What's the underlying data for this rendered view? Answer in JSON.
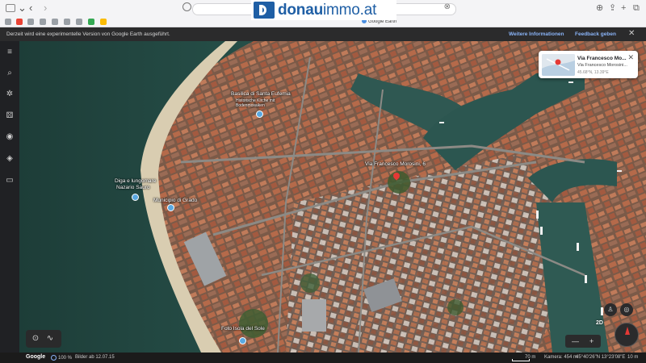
{
  "browser": {
    "tab_title": "Google Earth",
    "favorites_icons": [
      "gmail-icon",
      "bookmark-icon",
      "app-icon",
      "app-icon",
      "app-icon",
      "app-icon",
      "app-icon",
      "google-icon"
    ]
  },
  "brand": {
    "name_bold": "donau",
    "name_light": "immo.at",
    "color": "#1f5fa5"
  },
  "infobar": {
    "message": "Derzeit wird eine experimentelle Version von Google Earth ausgeführt.",
    "more_info": "Weitere Informationen",
    "feedback": "Feedback geben"
  },
  "map": {
    "labels": {
      "basilica": "Basilica di Santa Eufemia",
      "basilica_sub": "Historische Kirche mit Bodenmosaiken",
      "diga_1": "Diga e lungomare",
      "diga_2": "Nazario Sauro",
      "municipio": "Municipio di Grado",
      "address": "Via Francesco Morosini, 6",
      "isola": "Foto Isola del Sole"
    }
  },
  "place_card": {
    "title": "Via Francesco Mo...",
    "subtitle": "Via Francesco Morosini...",
    "coords": "45.68°N, 13.39°E"
  },
  "statusbar": {
    "google": "Google",
    "loading": "100 %",
    "imagery_date": "Bilder ab 12.07.15",
    "scale": "70 m",
    "camera": "Kamera: 454 m",
    "coordinates": "45°40'26\"N 13°23'08\"E",
    "altitude": "10 m"
  },
  "controls": {
    "view_2d": "2D",
    "zoom_minus": "—",
    "zoom_plus": "+"
  }
}
